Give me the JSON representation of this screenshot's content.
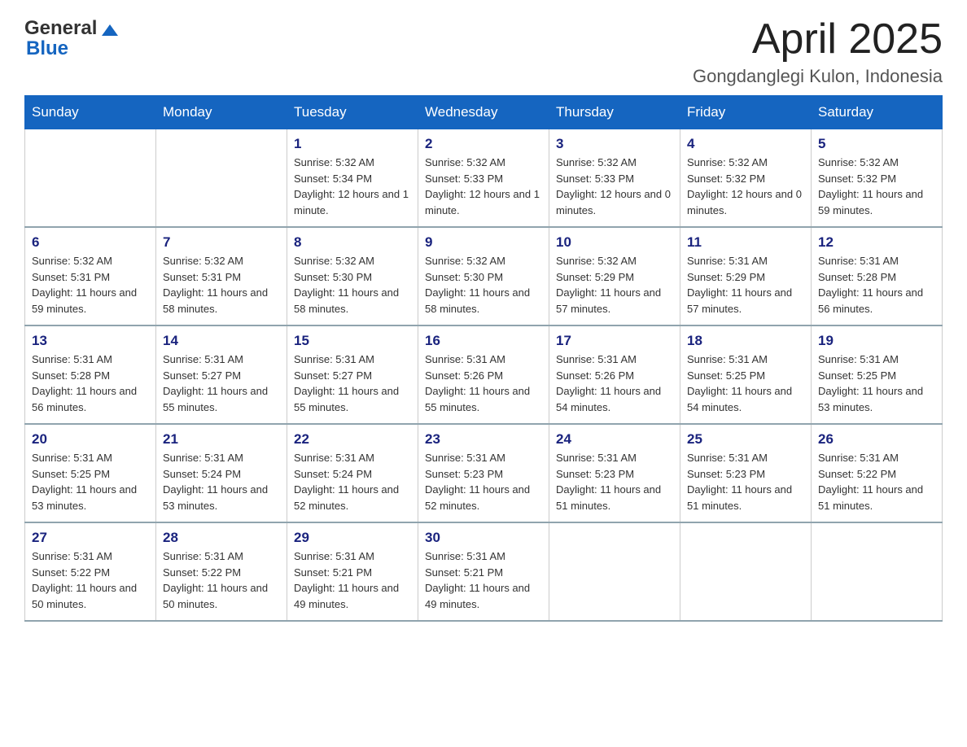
{
  "header": {
    "logo_general": "General",
    "logo_blue": "Blue",
    "month_title": "April 2025",
    "location": "Gongdanglegi Kulon, Indonesia"
  },
  "weekdays": [
    "Sunday",
    "Monday",
    "Tuesday",
    "Wednesday",
    "Thursday",
    "Friday",
    "Saturday"
  ],
  "weeks": [
    [
      {
        "day": "",
        "sunrise": "",
        "sunset": "",
        "daylight": ""
      },
      {
        "day": "",
        "sunrise": "",
        "sunset": "",
        "daylight": ""
      },
      {
        "day": "1",
        "sunrise": "Sunrise: 5:32 AM",
        "sunset": "Sunset: 5:34 PM",
        "daylight": "Daylight: 12 hours and 1 minute."
      },
      {
        "day": "2",
        "sunrise": "Sunrise: 5:32 AM",
        "sunset": "Sunset: 5:33 PM",
        "daylight": "Daylight: 12 hours and 1 minute."
      },
      {
        "day": "3",
        "sunrise": "Sunrise: 5:32 AM",
        "sunset": "Sunset: 5:33 PM",
        "daylight": "Daylight: 12 hours and 0 minutes."
      },
      {
        "day": "4",
        "sunrise": "Sunrise: 5:32 AM",
        "sunset": "Sunset: 5:32 PM",
        "daylight": "Daylight: 12 hours and 0 minutes."
      },
      {
        "day": "5",
        "sunrise": "Sunrise: 5:32 AM",
        "sunset": "Sunset: 5:32 PM",
        "daylight": "Daylight: 11 hours and 59 minutes."
      }
    ],
    [
      {
        "day": "6",
        "sunrise": "Sunrise: 5:32 AM",
        "sunset": "Sunset: 5:31 PM",
        "daylight": "Daylight: 11 hours and 59 minutes."
      },
      {
        "day": "7",
        "sunrise": "Sunrise: 5:32 AM",
        "sunset": "Sunset: 5:31 PM",
        "daylight": "Daylight: 11 hours and 58 minutes."
      },
      {
        "day": "8",
        "sunrise": "Sunrise: 5:32 AM",
        "sunset": "Sunset: 5:30 PM",
        "daylight": "Daylight: 11 hours and 58 minutes."
      },
      {
        "day": "9",
        "sunrise": "Sunrise: 5:32 AM",
        "sunset": "Sunset: 5:30 PM",
        "daylight": "Daylight: 11 hours and 58 minutes."
      },
      {
        "day": "10",
        "sunrise": "Sunrise: 5:32 AM",
        "sunset": "Sunset: 5:29 PM",
        "daylight": "Daylight: 11 hours and 57 minutes."
      },
      {
        "day": "11",
        "sunrise": "Sunrise: 5:31 AM",
        "sunset": "Sunset: 5:29 PM",
        "daylight": "Daylight: 11 hours and 57 minutes."
      },
      {
        "day": "12",
        "sunrise": "Sunrise: 5:31 AM",
        "sunset": "Sunset: 5:28 PM",
        "daylight": "Daylight: 11 hours and 56 minutes."
      }
    ],
    [
      {
        "day": "13",
        "sunrise": "Sunrise: 5:31 AM",
        "sunset": "Sunset: 5:28 PM",
        "daylight": "Daylight: 11 hours and 56 minutes."
      },
      {
        "day": "14",
        "sunrise": "Sunrise: 5:31 AM",
        "sunset": "Sunset: 5:27 PM",
        "daylight": "Daylight: 11 hours and 55 minutes."
      },
      {
        "day": "15",
        "sunrise": "Sunrise: 5:31 AM",
        "sunset": "Sunset: 5:27 PM",
        "daylight": "Daylight: 11 hours and 55 minutes."
      },
      {
        "day": "16",
        "sunrise": "Sunrise: 5:31 AM",
        "sunset": "Sunset: 5:26 PM",
        "daylight": "Daylight: 11 hours and 55 minutes."
      },
      {
        "day": "17",
        "sunrise": "Sunrise: 5:31 AM",
        "sunset": "Sunset: 5:26 PM",
        "daylight": "Daylight: 11 hours and 54 minutes."
      },
      {
        "day": "18",
        "sunrise": "Sunrise: 5:31 AM",
        "sunset": "Sunset: 5:25 PM",
        "daylight": "Daylight: 11 hours and 54 minutes."
      },
      {
        "day": "19",
        "sunrise": "Sunrise: 5:31 AM",
        "sunset": "Sunset: 5:25 PM",
        "daylight": "Daylight: 11 hours and 53 minutes."
      }
    ],
    [
      {
        "day": "20",
        "sunrise": "Sunrise: 5:31 AM",
        "sunset": "Sunset: 5:25 PM",
        "daylight": "Daylight: 11 hours and 53 minutes."
      },
      {
        "day": "21",
        "sunrise": "Sunrise: 5:31 AM",
        "sunset": "Sunset: 5:24 PM",
        "daylight": "Daylight: 11 hours and 53 minutes."
      },
      {
        "day": "22",
        "sunrise": "Sunrise: 5:31 AM",
        "sunset": "Sunset: 5:24 PM",
        "daylight": "Daylight: 11 hours and 52 minutes."
      },
      {
        "day": "23",
        "sunrise": "Sunrise: 5:31 AM",
        "sunset": "Sunset: 5:23 PM",
        "daylight": "Daylight: 11 hours and 52 minutes."
      },
      {
        "day": "24",
        "sunrise": "Sunrise: 5:31 AM",
        "sunset": "Sunset: 5:23 PM",
        "daylight": "Daylight: 11 hours and 51 minutes."
      },
      {
        "day": "25",
        "sunrise": "Sunrise: 5:31 AM",
        "sunset": "Sunset: 5:23 PM",
        "daylight": "Daylight: 11 hours and 51 minutes."
      },
      {
        "day": "26",
        "sunrise": "Sunrise: 5:31 AM",
        "sunset": "Sunset: 5:22 PM",
        "daylight": "Daylight: 11 hours and 51 minutes."
      }
    ],
    [
      {
        "day": "27",
        "sunrise": "Sunrise: 5:31 AM",
        "sunset": "Sunset: 5:22 PM",
        "daylight": "Daylight: 11 hours and 50 minutes."
      },
      {
        "day": "28",
        "sunrise": "Sunrise: 5:31 AM",
        "sunset": "Sunset: 5:22 PM",
        "daylight": "Daylight: 11 hours and 50 minutes."
      },
      {
        "day": "29",
        "sunrise": "Sunrise: 5:31 AM",
        "sunset": "Sunset: 5:21 PM",
        "daylight": "Daylight: 11 hours and 49 minutes."
      },
      {
        "day": "30",
        "sunrise": "Sunrise: 5:31 AM",
        "sunset": "Sunset: 5:21 PM",
        "daylight": "Daylight: 11 hours and 49 minutes."
      },
      {
        "day": "",
        "sunrise": "",
        "sunset": "",
        "daylight": ""
      },
      {
        "day": "",
        "sunrise": "",
        "sunset": "",
        "daylight": ""
      },
      {
        "day": "",
        "sunrise": "",
        "sunset": "",
        "daylight": ""
      }
    ]
  ]
}
